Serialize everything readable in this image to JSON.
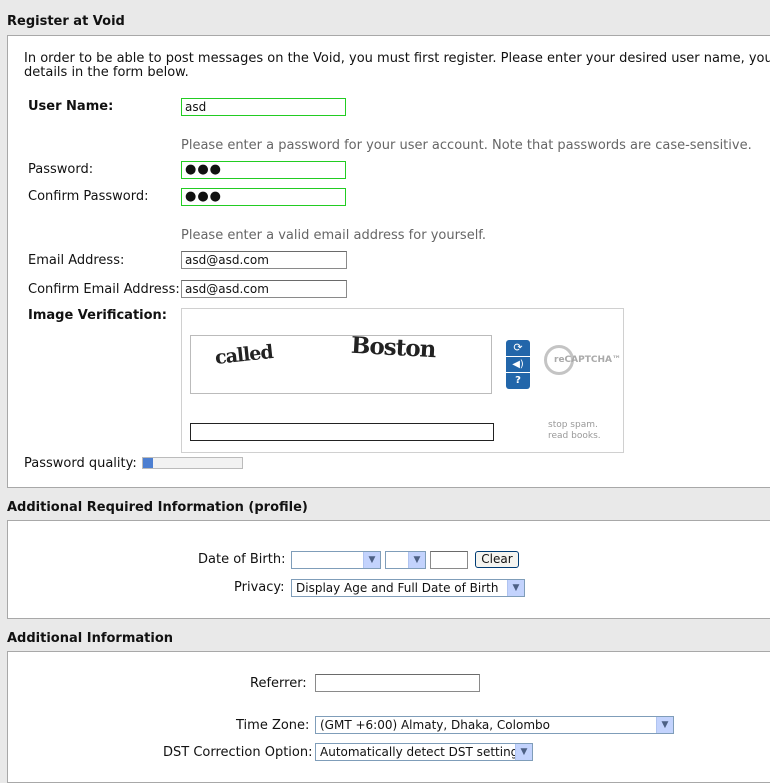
{
  "register": {
    "header": "Register at Void",
    "intro_line1": "In order to be able to post messages on the Void, you must first register. Please enter your desired user name, your e",
    "intro_line2": "details in the form below.",
    "username_label": "User Name:",
    "username_value": "asd",
    "password_hint": "Please enter a password for your user account. Note that passwords are case-sensitive.",
    "password_label": "Password:",
    "password_value": "●●●",
    "confirm_password_label": "Confirm Password:",
    "confirm_password_value": "●●●",
    "email_hint": "Please enter a valid email address for yourself.",
    "email_label": "Email Address:",
    "email_value": "asd@asd.com",
    "confirm_email_label": "Confirm Email Address:",
    "confirm_email_value": "asd@asd.com",
    "image_verification_label": "Image Verification:",
    "captcha_word1": "called",
    "captcha_word2": "Boston",
    "recaptcha_logo": "reCAPTCHA™",
    "recaptcha_tag1": "stop spam.",
    "recaptcha_tag2": "read books.",
    "password_quality_label": "Password quality:",
    "password_quality_value": 0.1
  },
  "profile": {
    "header": "Additional Required Information (profile)",
    "dob_label": "Date of Birth:",
    "clear_button": "Clear",
    "privacy_label": "Privacy:",
    "privacy_value": "Display Age and Full Date of Birth"
  },
  "additional": {
    "header": "Additional Information",
    "referrer_label": "Referrer:",
    "timezone_label": "Time Zone:",
    "timezone_value": "(GMT +6:00) Almaty, Dhaka, Colombo",
    "dst_label": "DST Correction Option:",
    "dst_value": "Automatically detect DST settings"
  },
  "icons": {
    "reload": "refresh-icon",
    "audio": "speaker-icon",
    "help": "help-icon",
    "dropdown": "chevron-down-icon"
  },
  "colors": {
    "valid_border": "#22cc22",
    "panel_bg": "#ffffff",
    "page_bg": "#e9e9e9",
    "recaptcha_blue": "#2266aa"
  }
}
